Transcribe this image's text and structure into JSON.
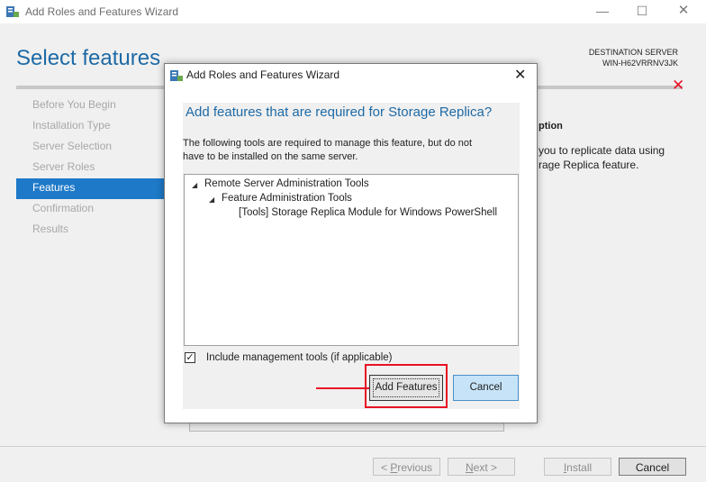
{
  "window": {
    "title": "Add Roles and Features Wizard",
    "page_title": "Select features",
    "destination_label": "DESTINATION SERVER",
    "destination_server": "WIN-H62VRRNV3JK",
    "error_icon": "red-x-icon"
  },
  "steps": [
    {
      "label": "Before You Begin",
      "active": false
    },
    {
      "label": "Installation Type",
      "active": false
    },
    {
      "label": "Server Selection",
      "active": false
    },
    {
      "label": "Server Roles",
      "active": false
    },
    {
      "label": "Features",
      "active": true
    },
    {
      "label": "Confirmation",
      "active": false
    },
    {
      "label": "Results",
      "active": false
    }
  ],
  "description": {
    "heading": "ption",
    "line1": "you to replicate data using",
    "line2": "rage Replica feature."
  },
  "bottom_buttons": {
    "previous": {
      "pre": "< ",
      "key": "P",
      "rest": "revious"
    },
    "next": {
      "key": "N",
      "rest": "ext >"
    },
    "install": {
      "key": "I",
      "rest": "nstall"
    },
    "cancel": "Cancel"
  },
  "dialog": {
    "title": "Add Roles and Features Wizard",
    "heading": "Add features that are required for Storage Replica?",
    "desc_line1": "The following tools are required to manage this feature, but do not",
    "desc_line2": "have to be installed on the same server.",
    "tree": {
      "level1": "Remote Server Administration Tools",
      "level2": "Feature Administration Tools",
      "level3": "[Tools] Storage Replica Module for Windows PowerShell"
    },
    "include_tools_label": "Include management tools (if applicable)",
    "include_tools_checked": true,
    "add_features": "Add Features",
    "cancel": "Cancel"
  },
  "colors": {
    "accent_blue": "#1e79c8",
    "heading_blue": "#1e6aa6",
    "highlight_red": "#e81123",
    "cancel_bg": "#c7e3f8"
  }
}
